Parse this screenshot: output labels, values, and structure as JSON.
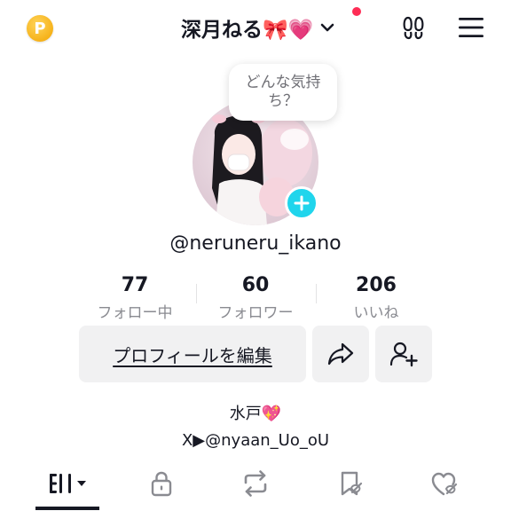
{
  "header": {
    "coin_icon": "coin-p-icon",
    "coin_letter": "P",
    "account_name": "深月ねる🎀💗",
    "notification_color": "#fe2c55",
    "footprints_icon": "footprints-icon",
    "menu_icon": "hamburger-menu-icon"
  },
  "status_bubble": {
    "line1": "どんな気持",
    "line2": "ち？"
  },
  "profile": {
    "avatar_icon": "profile-photo",
    "add_icon": "plus-icon",
    "add_color": "#20d5ec",
    "username": "@neruneru_ikano"
  },
  "stats": [
    {
      "value": "77",
      "label": "フォロー中"
    },
    {
      "value": "60",
      "label": "フォロワー"
    },
    {
      "value": "206",
      "label": "いいね"
    }
  ],
  "actions": {
    "edit_profile": "プロフィールを編集",
    "share_icon": "share-arrow-icon",
    "add_friend_icon": "add-friend-icon"
  },
  "bio": {
    "line1": "水戸💖",
    "line2": "X▶@nyaan_Uo_oU"
  },
  "tabs": [
    {
      "icon": "videos-grid-icon",
      "active": true
    },
    {
      "icon": "lock-icon",
      "active": false
    },
    {
      "icon": "repost-icon",
      "active": false
    },
    {
      "icon": "favorites-icon",
      "active": false
    },
    {
      "icon": "liked-icon",
      "active": false
    }
  ]
}
